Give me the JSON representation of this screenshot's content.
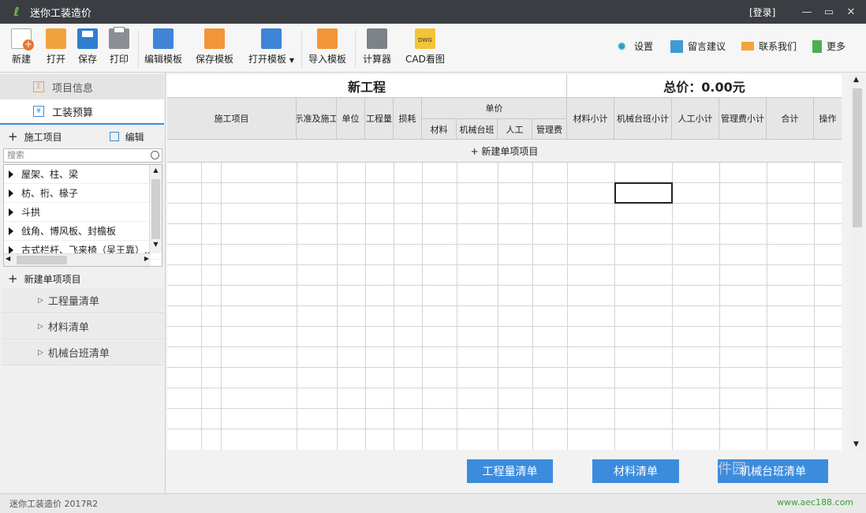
{
  "titlebar": {
    "title": "迷你工装造价",
    "login": "[登录]",
    "min": "—",
    "max": "▭",
    "close": "✕"
  },
  "toolbar": {
    "new": "新建",
    "open": "打开",
    "save": "保存",
    "print": "打印",
    "edit_template": "编辑模板",
    "save_template": "保存模板",
    "open_template": "打开模板",
    "import_template": "导入模板",
    "calculator": "计算器",
    "cad": "CAD看图",
    "settings": "设置",
    "feedback": "留言建议",
    "contact": "联系我们",
    "more": "更多"
  },
  "left": {
    "tab_project_info": "项目信息",
    "tab_budget": "工装预算",
    "construction_items": "施工项目",
    "edit": "编辑",
    "search_placeholder": "搜索",
    "tree": [
      "屋架、柱、梁",
      "枋、桁、椽子",
      "斗拱",
      "戗角、博风板、封檐板",
      "古式栏杆、飞来椅（吴王靠）..."
    ],
    "new_single_item": "新建单项项目",
    "links": [
      "工程量清单",
      "材料清单",
      "机械台班清单"
    ]
  },
  "sheet": {
    "project_title": "新工程",
    "total": "总价：0.00元",
    "headers": {
      "item": "施工项目",
      "std": "示准及施工",
      "unit": "单位",
      "qty": "工程量",
      "loss": "损耗",
      "unit_price": "单价",
      "material": "材料",
      "machine": "机械台班",
      "labor": "人工",
      "mgmt": "管理费",
      "material_sub": "材料小计",
      "machine_sub": "机械台班小计",
      "labor_sub": "人工小计",
      "mgmt_sub": "管理费小计",
      "total": "合计",
      "op": "操作"
    },
    "new_item_row": "+ 新建单项项目"
  },
  "bottom_buttons": {
    "quantity": "工程量清单",
    "material": "材料清单",
    "machine": "机械台班清单"
  },
  "status": {
    "version": "迷你工装造价  2017R2"
  },
  "watermark": {
    "text": "件园",
    "url": "www.aec188.com"
  },
  "colors": {
    "titlebar": "#3a3d42",
    "accent": "#3c8cde",
    "header_bg": "#e6e6e6"
  }
}
